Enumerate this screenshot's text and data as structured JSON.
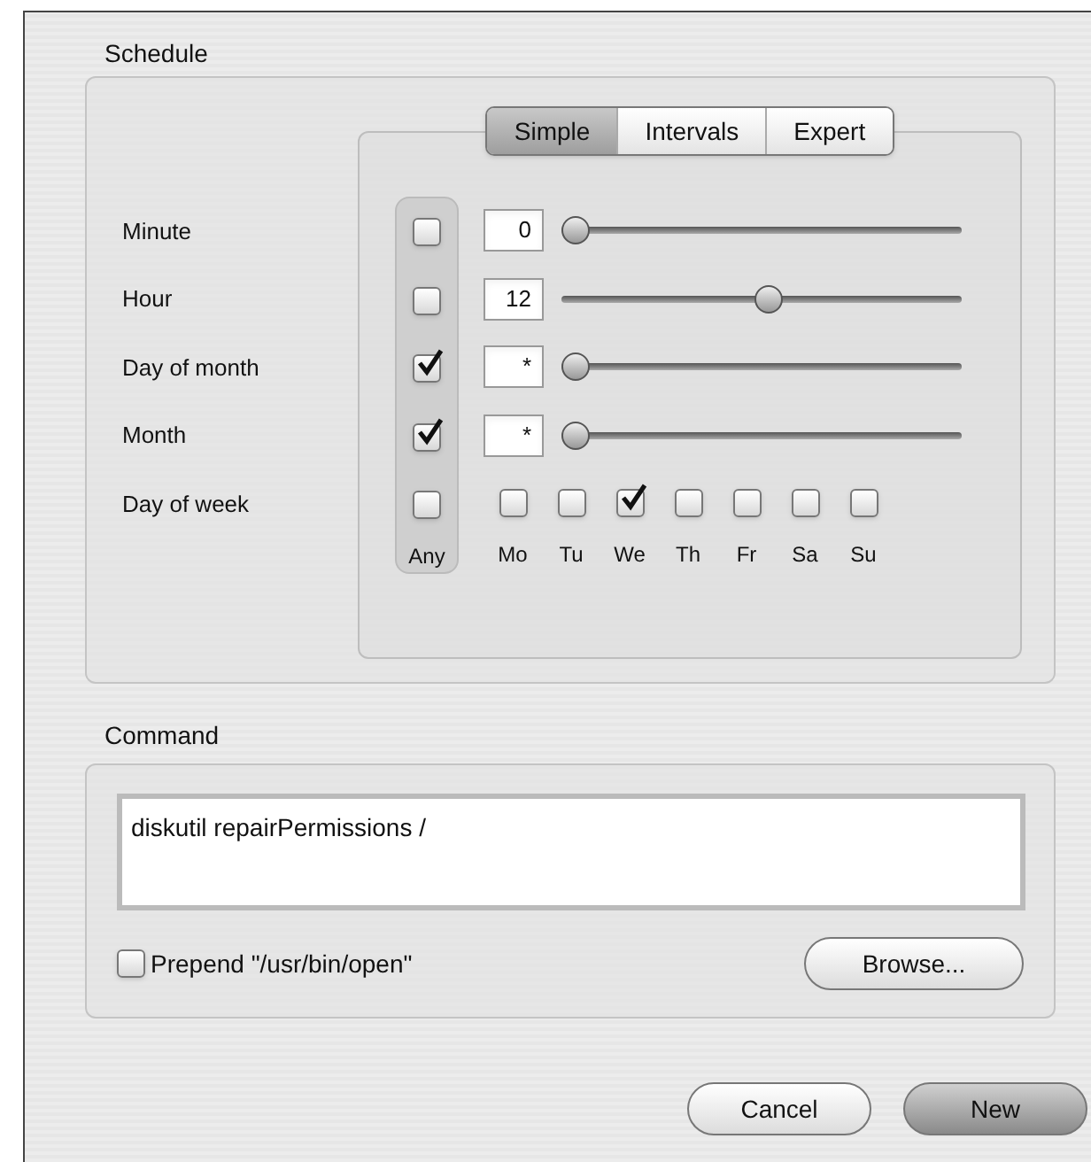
{
  "schedule": {
    "title": "Schedule",
    "tabs": [
      {
        "label": "Simple",
        "selected": true
      },
      {
        "label": "Intervals",
        "selected": false
      },
      {
        "label": "Expert",
        "selected": false
      }
    ],
    "rows": [
      {
        "label": "Minute",
        "kind": "slider",
        "any": false,
        "value": "0",
        "level": 0
      },
      {
        "label": "Hour",
        "kind": "slider",
        "any": false,
        "value": "12",
        "level": 0.52
      },
      {
        "label": "Day of month",
        "kind": "slider",
        "any": true,
        "value": "*",
        "level": 0
      },
      {
        "label": "Month",
        "kind": "slider",
        "any": true,
        "value": "*",
        "level": 0
      },
      {
        "label": "Day of week",
        "kind": "days",
        "any": false,
        "days": [
          {
            "label": "Mo",
            "checked": false
          },
          {
            "label": "Tu",
            "checked": false
          },
          {
            "label": "We",
            "checked": true
          },
          {
            "label": "Th",
            "checked": false
          },
          {
            "label": "Fr",
            "checked": false
          },
          {
            "label": "Sa",
            "checked": false
          },
          {
            "label": "Su",
            "checked": false
          }
        ]
      }
    ],
    "any_label": "Any"
  },
  "command": {
    "title": "Command",
    "value": "diskutil repairPermissions /",
    "prepend": {
      "label": "Prepend \"/usr/bin/open\"",
      "checked": false
    },
    "browse": "Browse..."
  },
  "buttons": [
    {
      "label": "Cancel",
      "default": false
    },
    {
      "label": "New",
      "default": true
    }
  ]
}
